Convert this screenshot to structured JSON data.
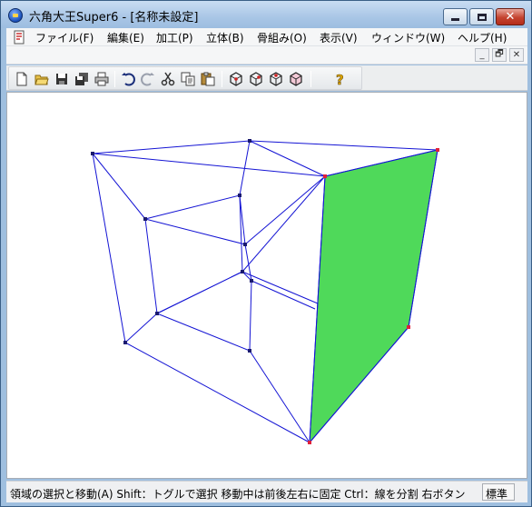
{
  "window": {
    "title": "六角大王Super6 - [名称未設定]",
    "buttons": {
      "minimize_icon": "minimize-icon",
      "maximize_icon": "maximize-icon",
      "close_icon": "close-icon"
    }
  },
  "menubar": {
    "items": [
      {
        "label": "ファイル(F)"
      },
      {
        "label": "編集(E)"
      },
      {
        "label": "加工(P)"
      },
      {
        "label": "立体(B)"
      },
      {
        "label": "骨組み(O)"
      },
      {
        "label": "表示(V)"
      },
      {
        "label": "ウィンドウ(W)"
      },
      {
        "label": "ヘルプ(H)"
      }
    ]
  },
  "mdi": {
    "buttons": [
      "_",
      "🗗",
      "✕"
    ]
  },
  "toolbar": {
    "buttons": [
      "new-document-icon",
      "open-folder-icon",
      "save-icon",
      "save-all-icon",
      "print-icon",
      "undo-icon",
      "redo-icon",
      "cut-icon",
      "copy-icon",
      "paste-icon",
      "view-front-icon",
      "view-side-icon",
      "view-top-icon",
      "view-perspective-icon",
      "help-icon"
    ]
  },
  "canvas": {
    "face_color": "#4fd95a",
    "line_color": "#1414d4",
    "point_color": "#1a1a6e",
    "selected_point_color": "#e0213a"
  },
  "statusbar": {
    "text": "領域の選択と移動(A)  Shift：トグルで選択 移動中は前後左右に固定    Ctrl：線を分割  右ボタン",
    "mode": "標準"
  }
}
